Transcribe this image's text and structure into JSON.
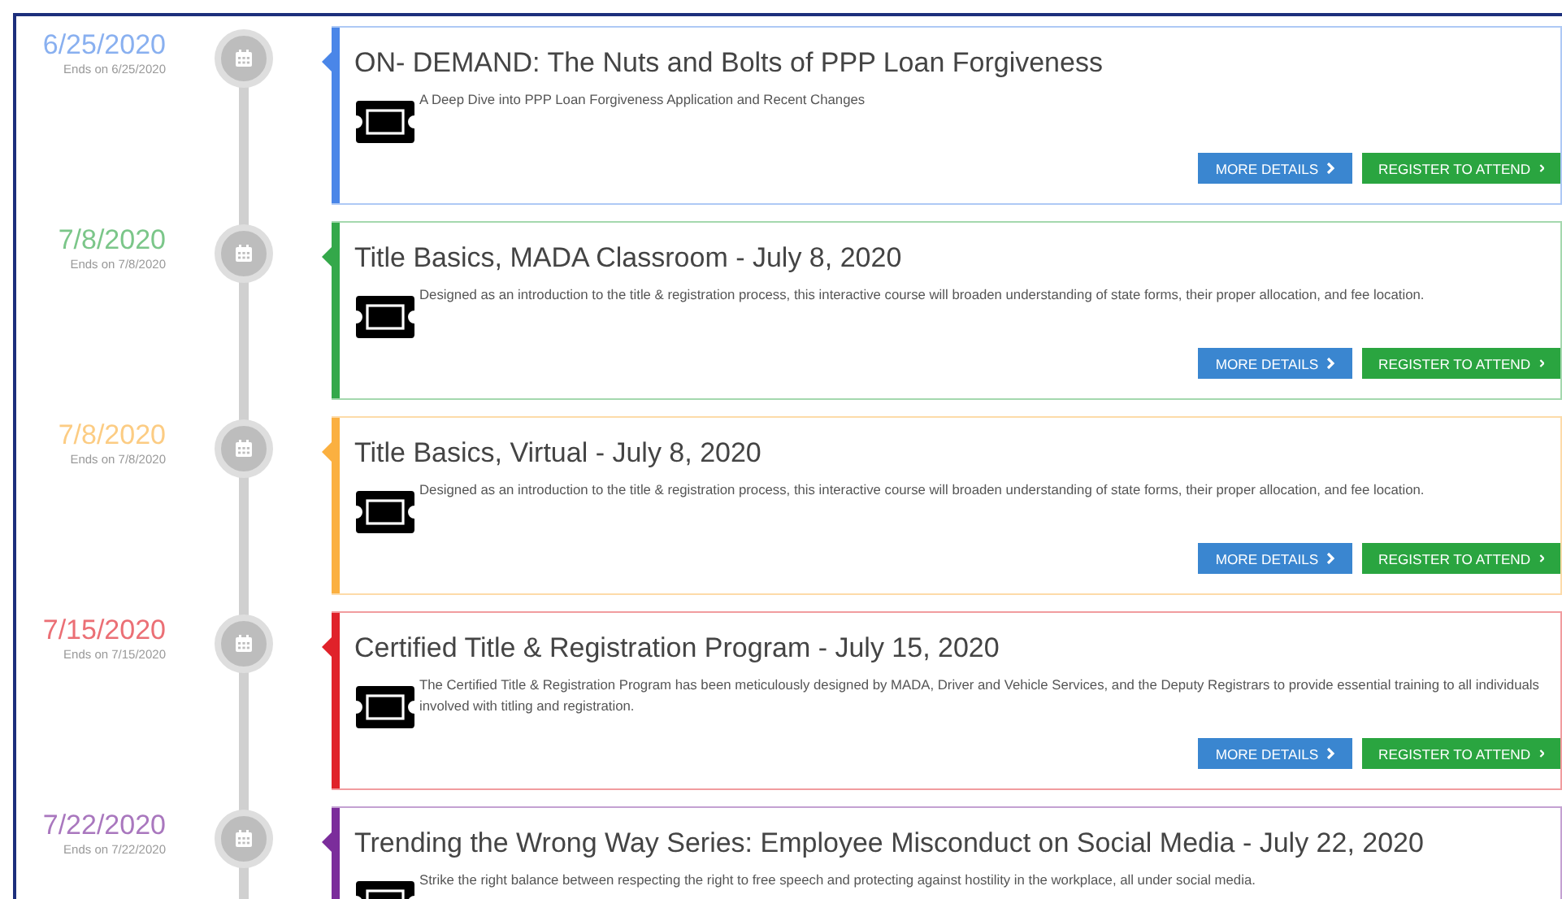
{
  "events": [
    {
      "date": "6/25/2020",
      "ends": "Ends on 6/25/2020",
      "color": "#4a86e8",
      "title": "ON- DEMAND: The Nuts and Bolts of PPP Loan Forgiveness",
      "description": "A Deep Dive into PPP Loan Forgiveness Application and Recent Changes",
      "buttons": [
        {
          "label": "MORE DETAILS",
          "kind": "details"
        },
        {
          "label": "REGISTER TO ATTEND",
          "kind": "register"
        }
      ]
    },
    {
      "date": "7/8/2020",
      "ends": "Ends on 7/8/2020",
      "color": "#34a84a",
      "title": "Title Basics, MADA Classroom - July 8, 2020",
      "description": "Designed as an introduction to the title & registration process, this interactive course will broaden understanding of state forms, their proper allocation, and fee location.",
      "buttons": [
        {
          "label": "MORE DETAILS",
          "kind": "details"
        },
        {
          "label": "REGISTER TO ATTEND",
          "kind": "register"
        }
      ]
    },
    {
      "date": "7/8/2020",
      "ends": "Ends on 7/8/2020",
      "color": "#fbb040",
      "title": "Title Basics, Virtual - July 8, 2020",
      "description": "Designed as an introduction to the title & registration process, this interactive course will broaden understanding of state forms, their proper allocation, and fee location.",
      "buttons": [
        {
          "label": "MORE DETAILS",
          "kind": "details"
        },
        {
          "label": "REGISTER TO ATTEND",
          "kind": "register"
        }
      ]
    },
    {
      "date": "7/15/2020",
      "ends": "Ends on 7/15/2020",
      "color": "#e0222a",
      "title": "Certified Title & Registration Program - July 15, 2020",
      "description": "The Certified Title & Registration Program has been meticulously designed by MADA, Driver and Vehicle Services, and the Deputy Registrars to provide essential training to all individuals involved with titling and registration.",
      "buttons": [
        {
          "label": "MORE DETAILS",
          "kind": "details"
        },
        {
          "label": "REGISTER TO ATTEND",
          "kind": "register"
        }
      ]
    },
    {
      "date": "7/22/2020",
      "ends": "Ends on 7/22/2020",
      "color": "#7b2d9b",
      "title": "Trending the Wrong Way Series: Employee Misconduct on Social Media - July 22, 2020",
      "description": "Strike the right balance between respecting the right to free speech and protecting against hostility in the workplace, all under social media."
    }
  ]
}
